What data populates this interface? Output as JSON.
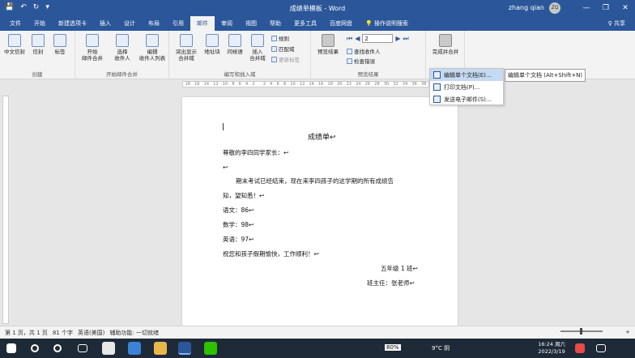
{
  "window": {
    "title": "成绩单模板 - Word",
    "user": "zhang qian",
    "avatar": "ZQ",
    "minimize": "—",
    "restore": "❐",
    "close": "✕"
  },
  "qat": {
    "save": "💾",
    "undo": "↶",
    "redo": "↻",
    "custom": "▾"
  },
  "menu": {
    "tabs": [
      "文件",
      "开始",
      "新建选项卡",
      "插入",
      "设计",
      "布局",
      "引用",
      "邮件",
      "审阅",
      "视图",
      "帮助",
      "更多工具",
      "百度网盘"
    ],
    "active_index": 7,
    "search": "💡 操作说明搜索",
    "share": "♀ 共享"
  },
  "ribbon": {
    "groups": [
      "创建",
      "开始邮件合并",
      "编写和插入域",
      "预览结果",
      "完成"
    ],
    "create": {
      "chinese_envelope": "中文信封",
      "envelope": "信封",
      "label": "标签"
    },
    "merge": {
      "start": "开始\n邮件合并",
      "select": "选择\n收件人",
      "edit": "编辑\n收件人列表"
    },
    "write": {
      "highlight": "突出显示\n合并域",
      "address": "地址块",
      "greeting": "问候语",
      "insert": "插入\n合并域",
      "rules": "规则",
      "match": "匹配域",
      "update": "更新标签"
    },
    "preview": {
      "preview_btn": "预览结果",
      "record": "2",
      "find": "查找收件人",
      "check": "检查错误"
    },
    "finish": {
      "finish_merge": "完成并合并"
    }
  },
  "dropdown": {
    "items": [
      "编辑单个文档(E)...",
      "打印文档(P)...",
      "发送电子邮件(S)..."
    ],
    "tooltip": "编辑单个文档 (Alt+Shift+N)"
  },
  "ruler": {
    "ticks": [
      "18",
      "16",
      "14",
      "12",
      "10",
      "8",
      "6",
      "4",
      "2",
      "",
      "2",
      "4",
      "6",
      "8",
      "10",
      "12",
      "14",
      "16",
      "18",
      "20",
      "22",
      "24",
      "26",
      "28",
      "30",
      "32",
      "34",
      "36",
      "38"
    ]
  },
  "document": {
    "title": "成绩单↩",
    "greeting": "尊敬的李四同学家长：↩",
    "blank": "↩",
    "para1": "期末考试已经结束，现在来李四孩子的这学期的所有成绩告",
    "para2": "知，望知悉！↩",
    "chinese": "语文：86↩",
    "math": "数学：98↩",
    "english": "英语：97↩",
    "wish": "祝您和孩子假期愉快，工作顺利！↩",
    "class": "五年级 1 班↩",
    "teacher": "班主任：张老师↩"
  },
  "status": {
    "page": "第 1 页，共 1 页",
    "words": "81 个字",
    "lang": "英语(美国)",
    "access": "辅助功能: 一切就绪",
    "zoom": "+"
  },
  "taskbar": {
    "battery": "80%",
    "weather": "9°C 阴",
    "time": "16:24 周六",
    "date": "2022/3/19"
  }
}
